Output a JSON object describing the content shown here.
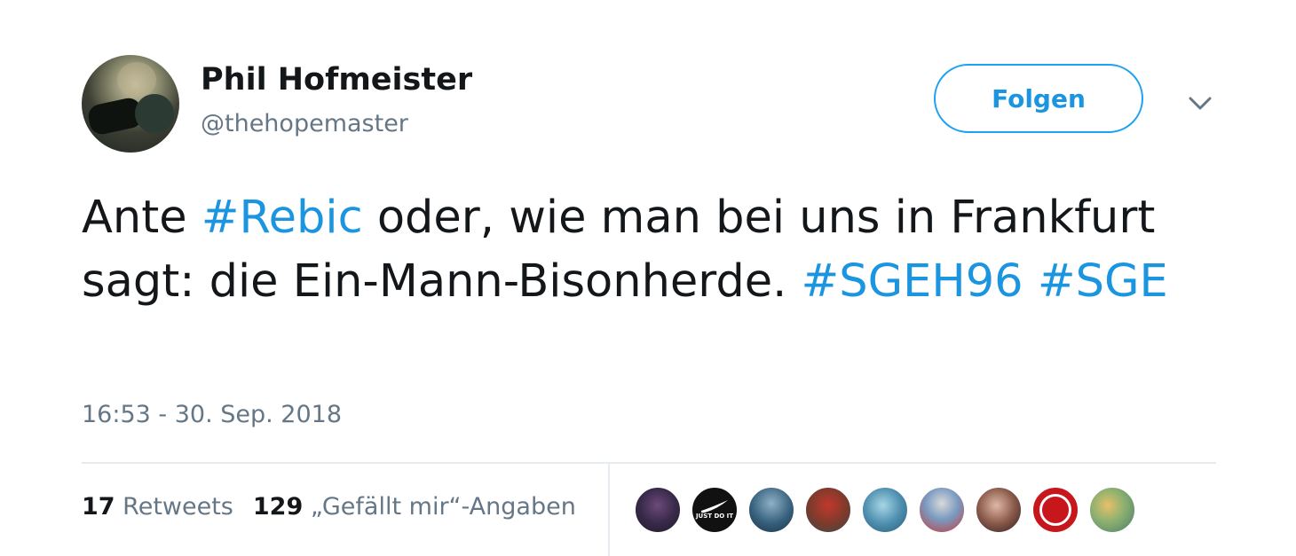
{
  "author": {
    "display_name": "Phil Hofmeister",
    "handle": "@thehopemaster"
  },
  "follow_button": {
    "label": "Folgen"
  },
  "tweet": {
    "segments": [
      {
        "text": "Ante ",
        "type": "text"
      },
      {
        "text": "#Rebic",
        "type": "hashtag"
      },
      {
        "text": " oder, wie man bei uns in Frankfurt sagt: die Ein-Mann-Bisonherde. ",
        "type": "text"
      },
      {
        "text": "#SGEH96",
        "type": "hashtag"
      },
      {
        "text": " ",
        "type": "text"
      },
      {
        "text": "#SGE",
        "type": "hashtag"
      }
    ],
    "timestamp": "16:53 - 30. Sep. 2018"
  },
  "stats": {
    "retweets_count": "17",
    "retweets_label": "Retweets",
    "likes_count": "129",
    "likes_label": "„Gefällt mir“-Angaben"
  },
  "likers": {
    "nike_text": "JUST DO IT"
  },
  "colors": {
    "accent": "#1da1f2",
    "link": "#1b95e0",
    "text_primary": "#14171a",
    "text_secondary": "#657786",
    "divider": "#e6ecf0"
  },
  "icons": {
    "menu": "chevron-down-icon"
  }
}
